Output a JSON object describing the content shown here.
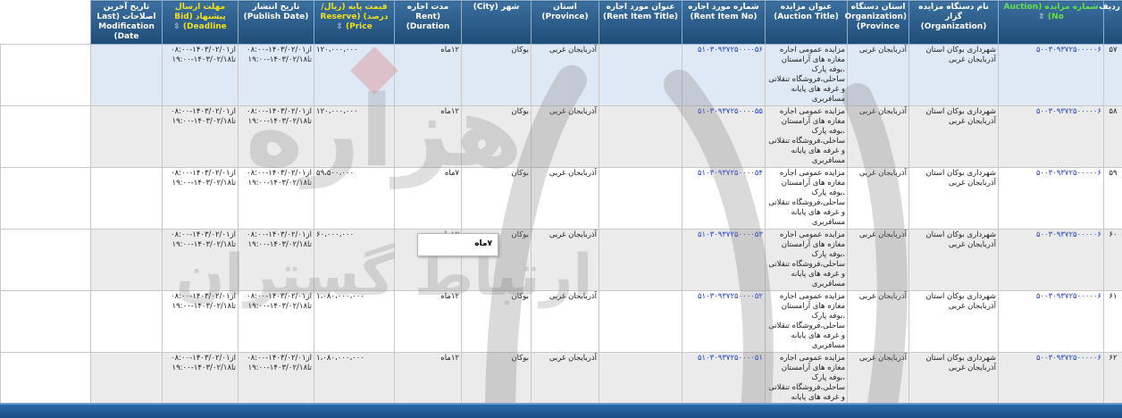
{
  "headers": {
    "row_no": "ردیف",
    "auction_no": "شماره مزایده (Auction No)",
    "organization": "نام دستگاه مزایده گزار (Organization)",
    "province_org": "استان دستگاه (Organization Province)",
    "auction_title": "عنوان مزایده (Auction Title)",
    "rent_item_no": "شماره مورد اجاره (Rent Item No)",
    "rent_item_title": "عنوان مورد اجاره (Rent Item Title)",
    "province": "استان (Province)",
    "city": "شهر (City)",
    "rent_duration": "مدت اجاره (Rent Duration)",
    "reserve_price": "قیمت پایه (ریال/درصد) (Reserve Price)",
    "publish_date": "تاریخ انتشار (Publish Date)",
    "deadline": "مهلت ارسال پیشنهاد (Bid Deadline)",
    "last_modification": "تاریخ آخرین اصلاحات (Last Modification Date)",
    "sort_glyph": "⇳"
  },
  "rows": [
    {
      "row_no": "۵۷",
      "auction_no": "۵۰۰۳۰۹۳۷۲۵۰۰۰۰۰۶",
      "organization": "شهرداری بوکان استان آذربایجان غربی",
      "province_org": "آذربایجان غربی",
      "auction_title": "مزایده عمومی اجاره مغازه های آرامستان ،بوفه پارک ساحلی،فروشگاه تنقلاتی و غرفه های پایانه مسافربری",
      "rent_item_no": "۵۱۰۳۰۹۳۷۲۵۰۰۰۰۵۶",
      "rent_item_title": "",
      "province": "آذربایجان غربی",
      "city": "بوکان",
      "rent_duration": "۱۲ماه",
      "reserve_price": "۱۲۰،۰۰۰،۰۰۰",
      "publish_date": "از۱۴۰۳/۰۲/۰۱-۰۸:۰۰ تا۱۴۰۳/۰۲/۱۸-۱۹:۰۰",
      "deadline": "از۱۴۰۳/۰۲/۰۱-۰۸:۰۰ تا۱۴۰۳/۰۲/۱۸-۱۹:۰۰",
      "last_modification": ""
    },
    {
      "row_no": "۵۸",
      "auction_no": "۵۰۰۳۰۹۳۷۲۵۰۰۰۰۰۶",
      "organization": "شهرداری بوکان استان آذربایجان غربی",
      "province_org": "آذربایجان غربی",
      "auction_title": "مزایده عمومی اجاره مغازه های آرامستان ،بوفه پارک ساحلی،فروشگاه تنقلاتی و غرفه های پایانه مسافربری",
      "rent_item_no": "۵۱۰۳۰۹۳۷۲۵۰۰۰۰۵۵",
      "rent_item_title": "",
      "province": "آذربایجان غربی",
      "city": "بوکان",
      "rent_duration": "۱۲ماه",
      "reserve_price": "۱۲۰،۰۰۰،۰۰۰",
      "publish_date": "از۱۴۰۳/۰۲/۰۱-۰۸:۰۰ تا۱۴۰۳/۰۲/۱۸-۱۹:۰۰",
      "deadline": "از۱۴۰۳/۰۲/۰۱-۰۸:۰۰ تا۱۴۰۳/۰۲/۱۸-۱۹:۰۰",
      "last_modification": ""
    },
    {
      "row_no": "۵۹",
      "auction_no": "۵۰۰۳۰۹۳۷۲۵۰۰۰۰۰۶",
      "organization": "شهرداری بوکان استان آذربایجان غربی",
      "province_org": "آذربایجان غربی",
      "auction_title": "مزایده عمومی اجاره مغازه های آرامستان ،بوفه پارک ساحلی،فروشگاه تنقلاتی و غرفه های پایانه مسافربری",
      "rent_item_no": "۵۱۰۳۰۹۳۷۲۵۰۰۰۰۵۴",
      "rent_item_title": "",
      "province": "آذربایجان غربی",
      "city": "بوکان",
      "rent_duration": "۷ماه",
      "reserve_price": "۵۹،۵۰۰،۰۰۰",
      "publish_date": "از۱۴۰۳/۰۲/۰۱-۰۸:۰۰ تا۱۴۰۳/۰۲/۱۸-۱۹:۰۰",
      "deadline": "از۱۴۰۳/۰۲/۰۱-۰۸:۰۰ تا۱۴۰۳/۰۲/۱۸-۱۹:۰۰",
      "last_modification": ""
    },
    {
      "row_no": "۶۰",
      "auction_no": "۵۰۰۳۰۹۳۷۲۵۰۰۰۰۰۶",
      "organization": "شهرداری بوکان استان آذربایجان غربی",
      "province_org": "آذربایجان غربی",
      "auction_title": "مزایده عمومی اجاره مغازه های آرامستان ،بوفه پارک ساحلی،فروشگاه تنقلاتی و غرفه های پایانه مسافربری",
      "rent_item_no": "۵۱۰۳۰۹۳۷۲۵۰۰۰۰۵۳",
      "rent_item_title": "",
      "province": "آذربایجان غربی",
      "city": "بوکان",
      "rent_duration": "۱۲ماه",
      "reserve_price": "۶۰،۰۰۰،۰۰۰",
      "publish_date": "از۱۴۰۳/۰۲/۰۱-۰۸:۰۰ تا۱۴۰۳/۰۲/۱۸-۱۹:۰۰",
      "deadline": "از۱۴۰۳/۰۲/۰۱-۰۸:۰۰ تا۱۴۰۳/۰۲/۱۸-۱۹:۰۰",
      "last_modification": ""
    },
    {
      "row_no": "۶۱",
      "auction_no": "۵۰۰۳۰۹۳۷۲۵۰۰۰۰۰۶",
      "organization": "شهرداری بوکان استان آذربایجان غربی",
      "province_org": "آذربایجان غربی",
      "auction_title": "مزایده عمومی اجاره مغازه های آرامستان ،بوفه پارک ساحلی،فروشگاه تنقلاتی و غرفه های پایانه مسافربری",
      "rent_item_no": "۵۱۰۳۰۹۳۷۲۵۰۰۰۰۵۲",
      "rent_item_title": "",
      "province": "آذربایجان غربی",
      "city": "بوکان",
      "rent_duration": "۱۲ماه",
      "reserve_price": "۱،۰۸۰،۰۰۰،۰۰۰",
      "publish_date": "از۱۴۰۳/۰۲/۰۱-۰۸:۰۰ تا۱۴۰۳/۰۲/۱۸-۱۹:۰۰",
      "deadline": "از۱۴۰۳/۰۲/۰۱-۰۸:۰۰ تا۱۴۰۳/۰۲/۱۸-۱۹:۰۰",
      "last_modification": ""
    },
    {
      "row_no": "۶۲",
      "auction_no": "۵۰۰۳۰۹۳۷۲۵۰۰۰۰۰۶",
      "organization": "شهرداری بوکان استان آذربایجان غربی",
      "province_org": "آذربایجان غربی",
      "auction_title": "مزایده عمومی اجاره مغازه های آرامستان ،بوفه پارک ساحلی،فروشگاه تنقلاتی و غرفه های پایانه مسافربری",
      "rent_item_no": "۵۱۰۳۰۹۳۷۲۵۰۰۰۰۵۱",
      "rent_item_title": "",
      "province": "آذربایجان غربی",
      "city": "بوکان",
      "rent_duration": "۱۲ماه",
      "reserve_price": "۱،۰۸۰،۰۰۰،۰۰۰",
      "publish_date": "از۱۴۰۳/۰۲/۰۱-۰۸:۰۰ تا۱۴۰۳/۰۲/۱۸-۱۹:۰۰",
      "deadline": "از۱۴۰۳/۰۲/۰۱-۰۸:۰۰ تا۱۴۰۳/۰۲/۱۸-۱۹:۰۰",
      "last_modification": ""
    }
  ],
  "tooltip": {
    "text": "۷ماه"
  },
  "watermark": {
    "word_main": "هزاره",
    "word_sub": "ارتباط گستران"
  },
  "colors": {
    "header_bg": "#1f4c78",
    "header_yellow": "#f0e020",
    "header_green": "#66e04a",
    "link_blue": "#1f3fd0",
    "selected_row": "#dfe9f5"
  }
}
